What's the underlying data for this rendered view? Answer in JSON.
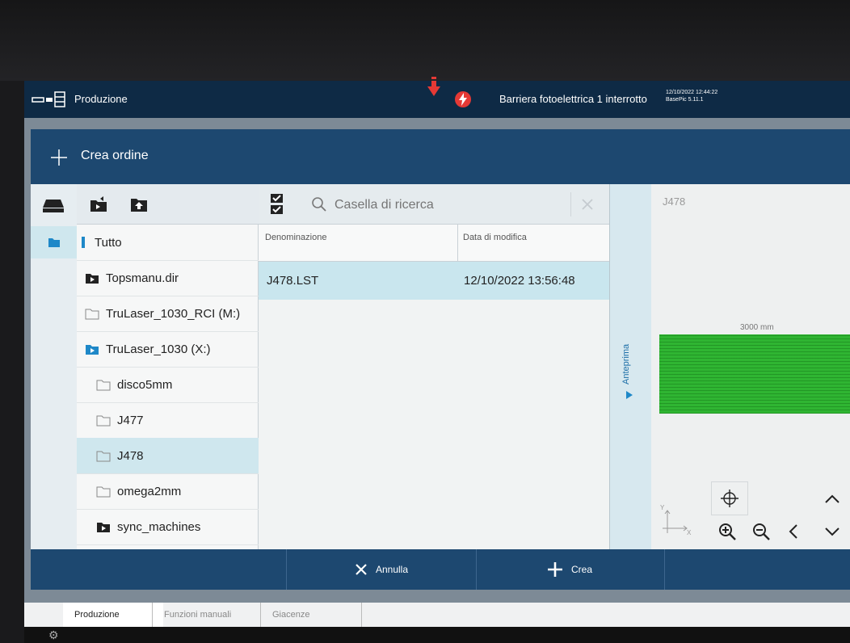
{
  "topbar": {
    "title": "Produzione",
    "alarm_text": "Barriera fotoelettrica 1 interrotto",
    "datetime": "12/10/2022 12:44:22",
    "version": "BasePic  5.11.1"
  },
  "dialog": {
    "title": "Crea ordine"
  },
  "search": {
    "placeholder": "Casella di ricerca"
  },
  "columns": {
    "name": "Denominazione",
    "modified": "Data di modifica"
  },
  "tree": {
    "items": [
      {
        "label": "Tutto"
      },
      {
        "label": "Topsmanu.dir"
      },
      {
        "label": "TruLaser_1030_RCI (M:)"
      },
      {
        "label": "TruLaser_1030 (X:)"
      },
      {
        "label": "disco5mm"
      },
      {
        "label": "J477"
      },
      {
        "label": "J478"
      },
      {
        "label": "omega2mm"
      },
      {
        "label": "sync_machines"
      }
    ]
  },
  "files": [
    {
      "name": "J478.LST",
      "modified": "12/10/2022 13:56:48"
    }
  ],
  "preview": {
    "tab_label": "Anteprima",
    "title": "J478",
    "dimension": "3000 mm",
    "axis_y": "Y",
    "axis_x": "X"
  },
  "actions": {
    "cancel": "Annulla",
    "create": "Crea"
  },
  "bottom_tabs": [
    {
      "label": "Produzione"
    },
    {
      "label": "Funzioni manuali"
    },
    {
      "label": "Giacenze"
    }
  ],
  "colors": {
    "header_blue": "#1d4870",
    "selection": "#cfe7ee",
    "alarm_red": "#e53935",
    "part_green": "#2fb532"
  }
}
